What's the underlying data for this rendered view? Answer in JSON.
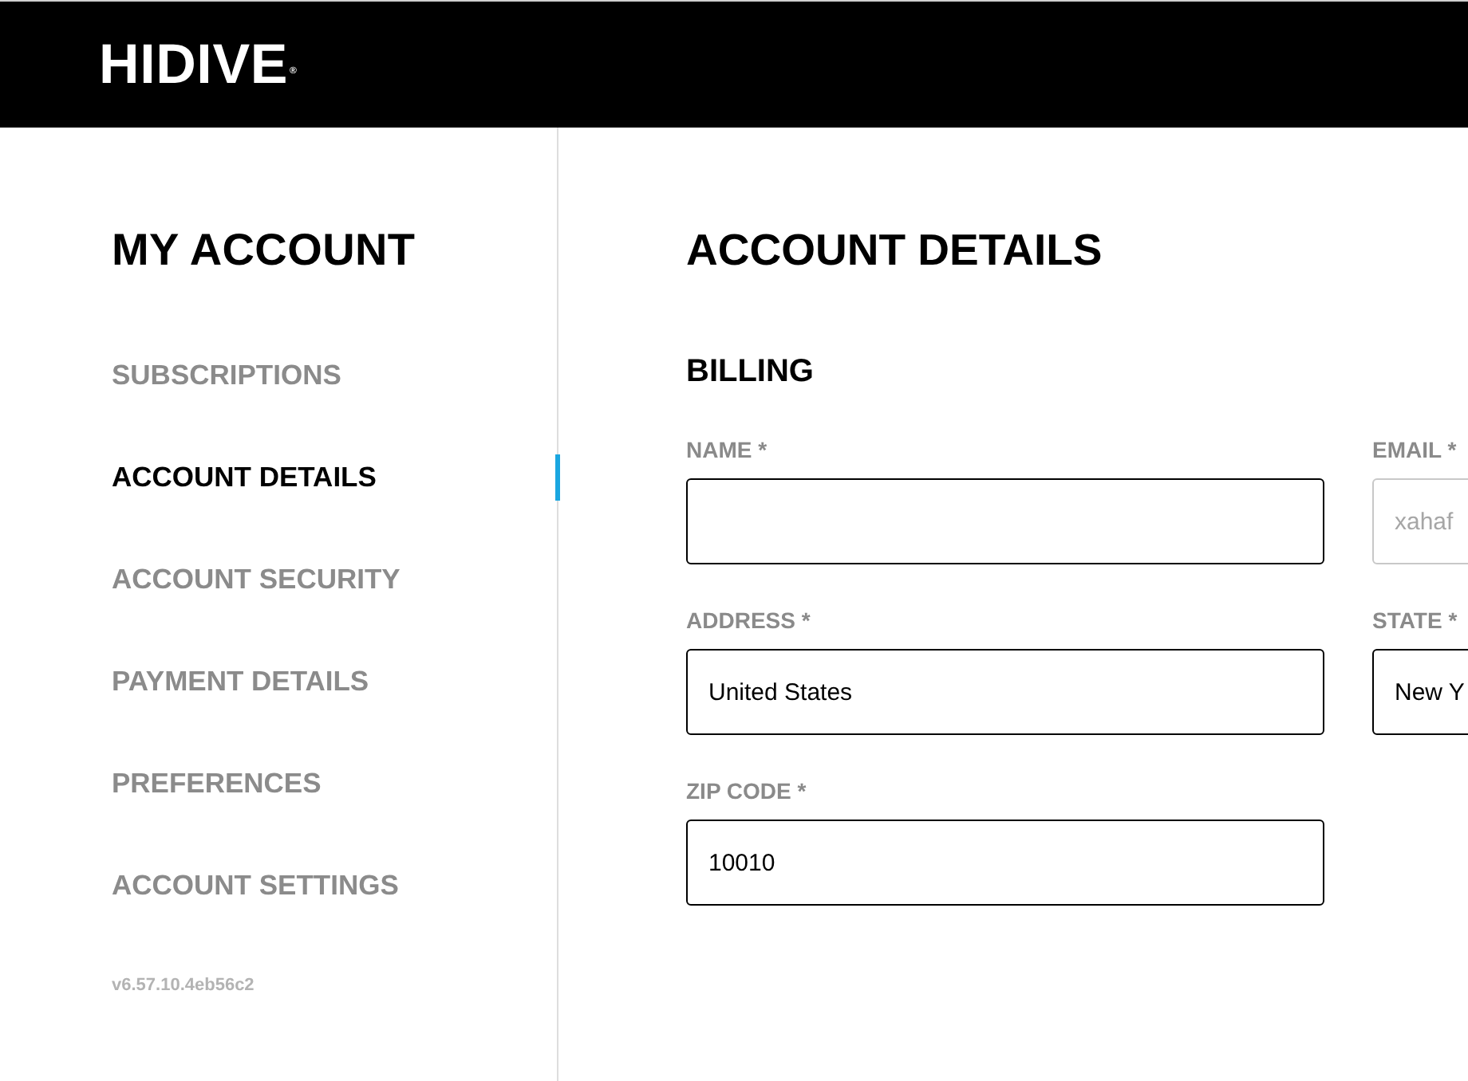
{
  "header": {
    "logo": "HIDIVE$^{®}$"
  },
  "sidebar": {
    "title": "MY ACCOUNT",
    "items": [
      {
        "label": "SUBSCRIPTIONS",
        "selected": false
      },
      {
        "label": "ACCOUNT DETAILS",
        "selected": true
      },
      {
        "label": "ACCOUNT SECURITY",
        "selected": false
      },
      {
        "label": "PAYMENT DETAILS",
        "selected": false
      },
      {
        "label": "PREFERENCES",
        "selected": false
      },
      {
        "label": "ACCOUNT SETTINGS",
        "selected": false
      }
    ],
    "version": "v6.57.10.4eb56c2"
  },
  "main": {
    "title": "ACCOUNT DETAILS",
    "section": "BILLING",
    "fields": [
      {
        "label": "NAME *",
        "disabled": false
      },
      {
        "label": "EMAIL *",
        "value": "xahaf",
        "disabled": true
      },
      {
        "label": "ADDRESS *",
        "value": "United States",
        "disabled": false
      },
      {
        "label": "STATE *",
        "value": "New Y",
        "disabled": false
      },
      {
        "label": "ZIP CODE *",
        "value": "10010",
        "disabled": false
      }
    ]
  }
}
